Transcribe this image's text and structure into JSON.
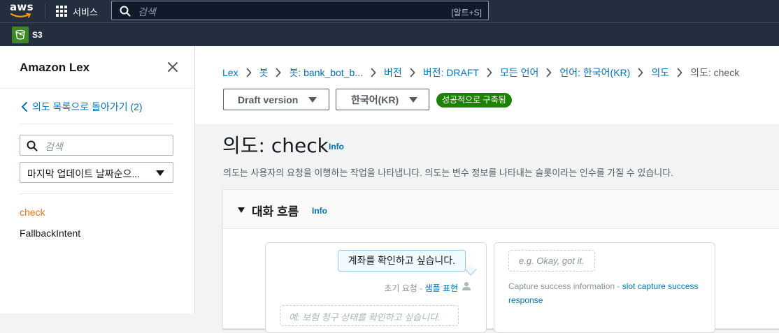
{
  "topnav": {
    "logo_text": "aws",
    "services_label": "서비스",
    "search_placeholder": "검색",
    "search_shortcut": "[알트+S]"
  },
  "service_bar": {
    "service_label": "S3"
  },
  "sidebar": {
    "title": "Amazon Lex",
    "back_link": "의도 목록으로 돌아가기 (2)",
    "search_placeholder": "검색",
    "sort_select": "마지막 업데이트 날짜순으...",
    "items": [
      {
        "label": "check",
        "active": true
      },
      {
        "label": "FallbackIntent",
        "active": false
      }
    ]
  },
  "breadcrumbs": [
    "Lex",
    "봇",
    "봇: bank_bot_b...",
    "버전",
    "버전: DRAFT",
    "모든 언어",
    "언어: 한국어(KR)",
    "의도",
    "의도: check"
  ],
  "toolbar": {
    "version_dropdown": "Draft version",
    "language_dropdown": "한국어(KR)",
    "build_status": "성공적으로 구축됨",
    "build_status_color": "#1d8102"
  },
  "intent": {
    "title": "의도: check",
    "info_label": "Info",
    "description": "의도는 사용자의 요청을 이행하는 작업을 나타냅니다. 의도는 변수 정보를 나타내는 슬롯이라는 인수를 가질 수 있습니다."
  },
  "conversation_flow": {
    "title": "대화 흐름",
    "info_label": "Info",
    "card1": {
      "utterance": "계좌를 확인하고 싶습니다.",
      "meta_prefix": "초기 요청 -",
      "meta_link": "샘플 표현",
      "next_placeholder": "예: 보험 청구 상태를 확인하고 싶습니다."
    },
    "card2": {
      "placeholder": "e.g. Okay, got it.",
      "caption_prefix": "Capture success information -",
      "caption_link": "slot capture success response"
    }
  }
}
